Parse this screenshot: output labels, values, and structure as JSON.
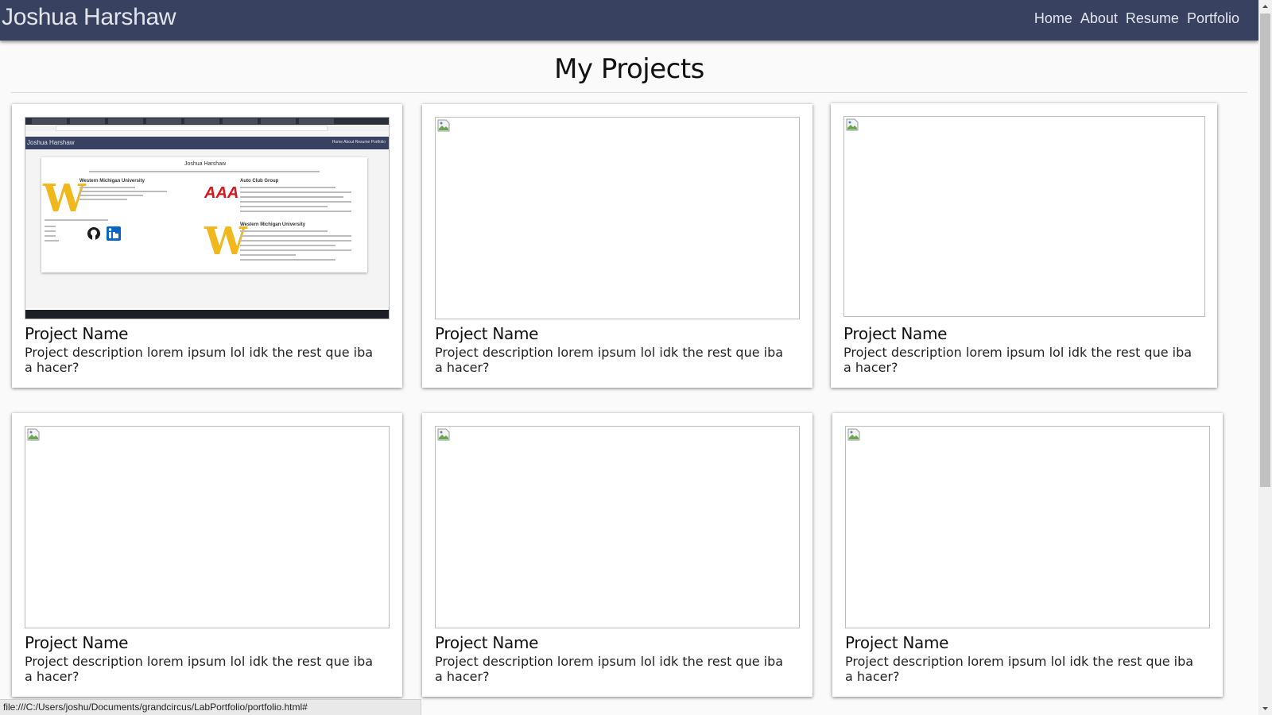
{
  "navbar": {
    "brand": "Joshua Harshaw",
    "links": [
      "Home",
      "About",
      "Resume",
      "Portfolio"
    ]
  },
  "page": {
    "heading": "My Projects"
  },
  "projects": [
    {
      "title": "Project Name",
      "description": "Project description lorem ipsum lol idk the rest que iba a hacer?",
      "image": "screenshot"
    },
    {
      "title": "Project Name",
      "description": "Project description lorem ipsum lol idk the rest que iba a hacer?",
      "image": "broken-image-icon"
    },
    {
      "title": "Project Name",
      "description": "Project description lorem ipsum lol idk the rest que iba a hacer?",
      "image": "broken-image-icon"
    },
    {
      "title": "Project Name",
      "description": "Project description lorem ipsum lol idk the rest que iba a hacer?",
      "image": "broken-image-icon"
    },
    {
      "title": "Project Name",
      "description": "Project description lorem ipsum lol idk the rest que iba a hacer?",
      "image": "broken-image-icon"
    },
    {
      "title": "Project Name",
      "description": "Project description lorem ipsum lol idk the rest que iba a hacer?",
      "image": "broken-image-icon"
    }
  ],
  "thumbnail": {
    "brand": "Joshua Harshaw",
    "nav": "Home  About  Resume  Portfolio",
    "resume_name": "Joshua Harshaw",
    "school": "Western Michigan University",
    "company": "Auto Club Group",
    "logo_w": "W",
    "logo_aaa": "AAA"
  },
  "status_bar": {
    "url": "file:///C:/Users/joshu/Documents/grandcircus/LabPortfolio/portfolio.html#"
  },
  "colors": {
    "navbar": "#394160",
    "page_background": "#fafafa",
    "card_background": "#ffffff"
  }
}
